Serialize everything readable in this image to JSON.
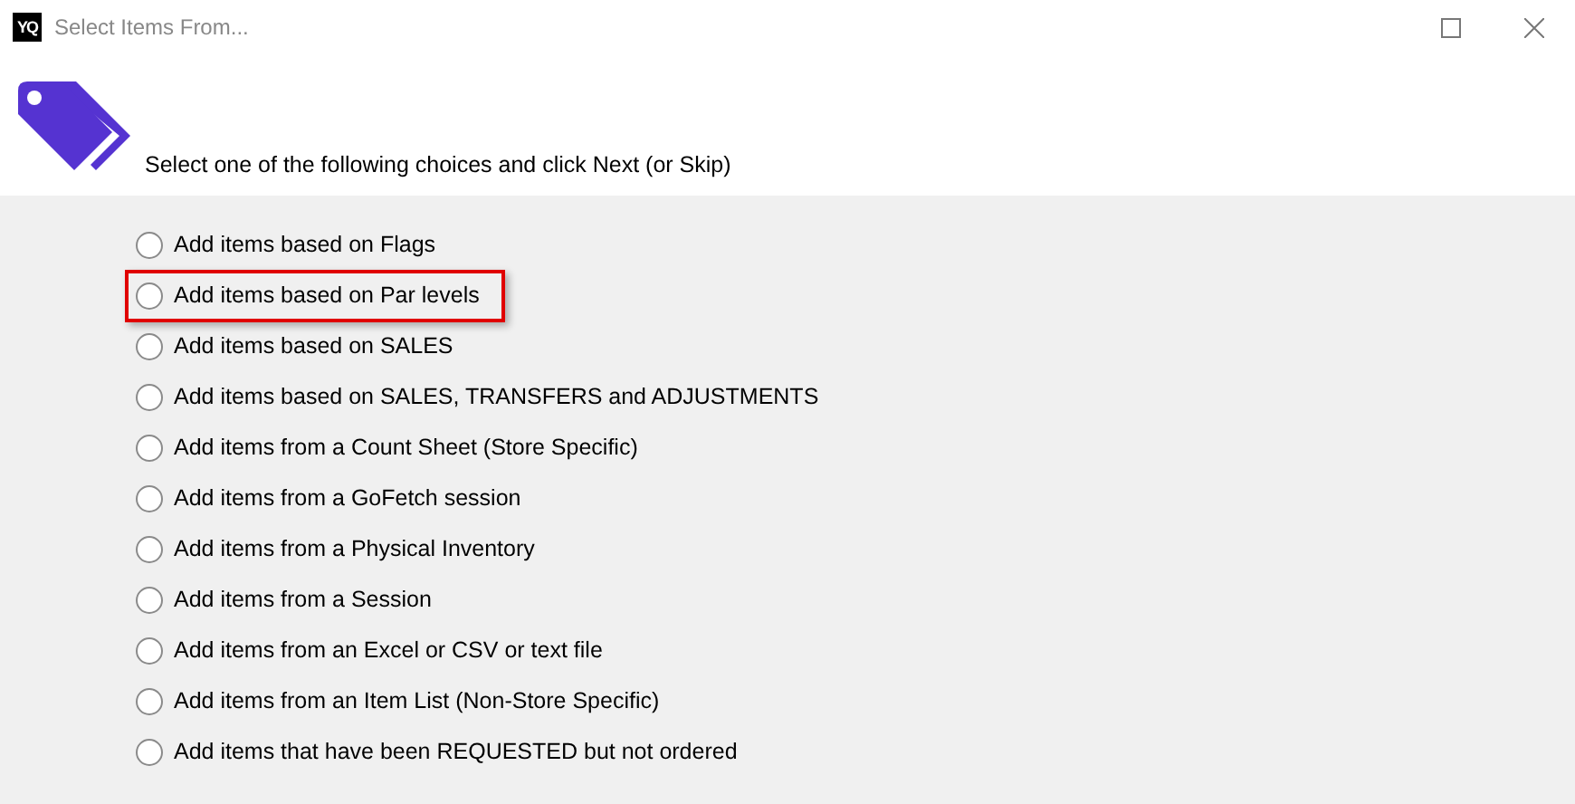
{
  "window": {
    "logo_text": "YQ",
    "title": "Select Items From..."
  },
  "header": {
    "instruction": "Select one of the following choices and click Next (or Skip)"
  },
  "options": [
    {
      "label": "Add items based on Flags",
      "selected": false,
      "highlighted": false
    },
    {
      "label": "Add items based on Par levels",
      "selected": false,
      "highlighted": true
    },
    {
      "label": "Add items based on SALES",
      "selected": false,
      "highlighted": false
    },
    {
      "label": "Add items based on SALES, TRANSFERS and ADJUSTMENTS",
      "selected": false,
      "highlighted": false
    },
    {
      "label": "Add items from a Count Sheet (Store Specific)",
      "selected": false,
      "highlighted": false
    },
    {
      "label": "Add items from a GoFetch session",
      "selected": false,
      "highlighted": false
    },
    {
      "label": "Add items from a Physical Inventory",
      "selected": false,
      "highlighted": false
    },
    {
      "label": "Add items from a Session",
      "selected": false,
      "highlighted": false
    },
    {
      "label": "Add items from an Excel or CSV or text file",
      "selected": false,
      "highlighted": false
    },
    {
      "label": "Add items from an Item List (Non-Store Specific)",
      "selected": false,
      "highlighted": false
    },
    {
      "label": "Add items that have been REQUESTED but not ordered",
      "selected": false,
      "highlighted": false
    }
  ]
}
